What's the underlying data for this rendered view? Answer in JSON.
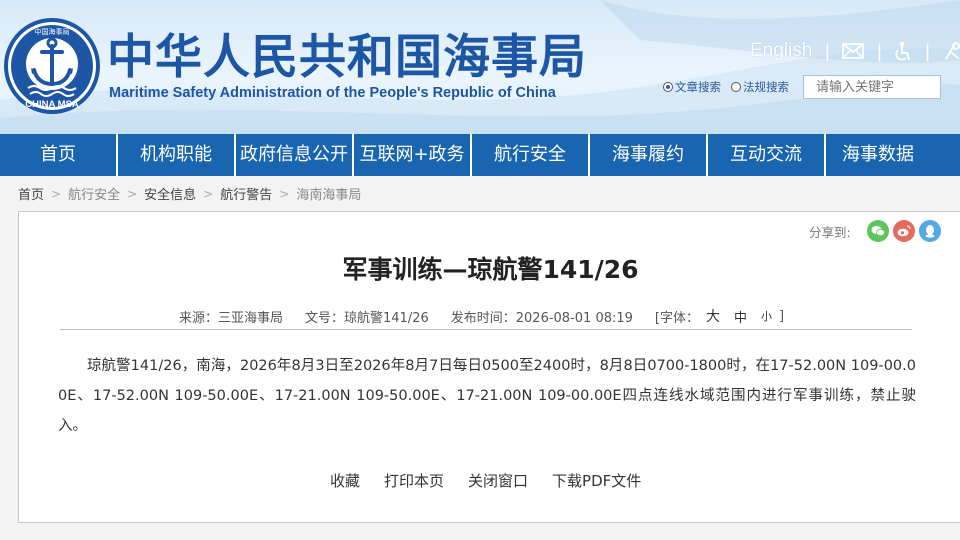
{
  "header": {
    "title": "中华人民共和国海事局",
    "subtitle": "Maritime Safety Administration of the People's Republic of China",
    "logo_text": "CHINA MSA",
    "logo_ring_text": "中国海事局",
    "english_link": "English",
    "separator": "|",
    "icons": [
      "mail-icon",
      "accessibility-icon",
      "tools-icon"
    ]
  },
  "search": {
    "option_article": "文章搜索",
    "option_regulation": "法规搜索",
    "selected": "文章搜索",
    "placeholder": "请输入关键字"
  },
  "nav": {
    "items": [
      "首页",
      "机构职能",
      "政府信息公开",
      "互联网+政务",
      "航行安全",
      "海事履约",
      "互动交流",
      "海事数据"
    ]
  },
  "breadcrumb": {
    "items": [
      "首页",
      "航行安全",
      "安全信息",
      "航行警告",
      "海南海事局"
    ],
    "arrow": ">"
  },
  "share": {
    "label": "分享到:",
    "icons": [
      "wechat-icon",
      "weibo-icon",
      "qq-icon"
    ]
  },
  "article": {
    "title": "军事训练—琼航警141/26",
    "source": "来源：三亚海事局",
    "doc_no": "文号：琼航警141/26",
    "publish_time": "发布时间：2026-08-01 08:19",
    "font_open": "[字体：",
    "font_large": "大",
    "font_mid": "中",
    "font_small": "小",
    "font_close": "]",
    "body": "琼航警141/26，南海，2026年8月3日至2026年8月7日每日0500至2400时，8月8日0700-1800时，在17-52.00N 109-00.00E、17-52.00N 109-50.00E、17-21.00N 109-50.00E、17-21.00N 109-00.00E四点连线水域范围内进行军事训练，禁止驶入。"
  },
  "actions": {
    "favorite": "收藏",
    "print": "打印本页",
    "close": "关闭窗口",
    "download_pdf": "下载PDF文件"
  },
  "colors": {
    "brand_blue": "#1c56a5",
    "nav_bg": "#1965b0"
  }
}
